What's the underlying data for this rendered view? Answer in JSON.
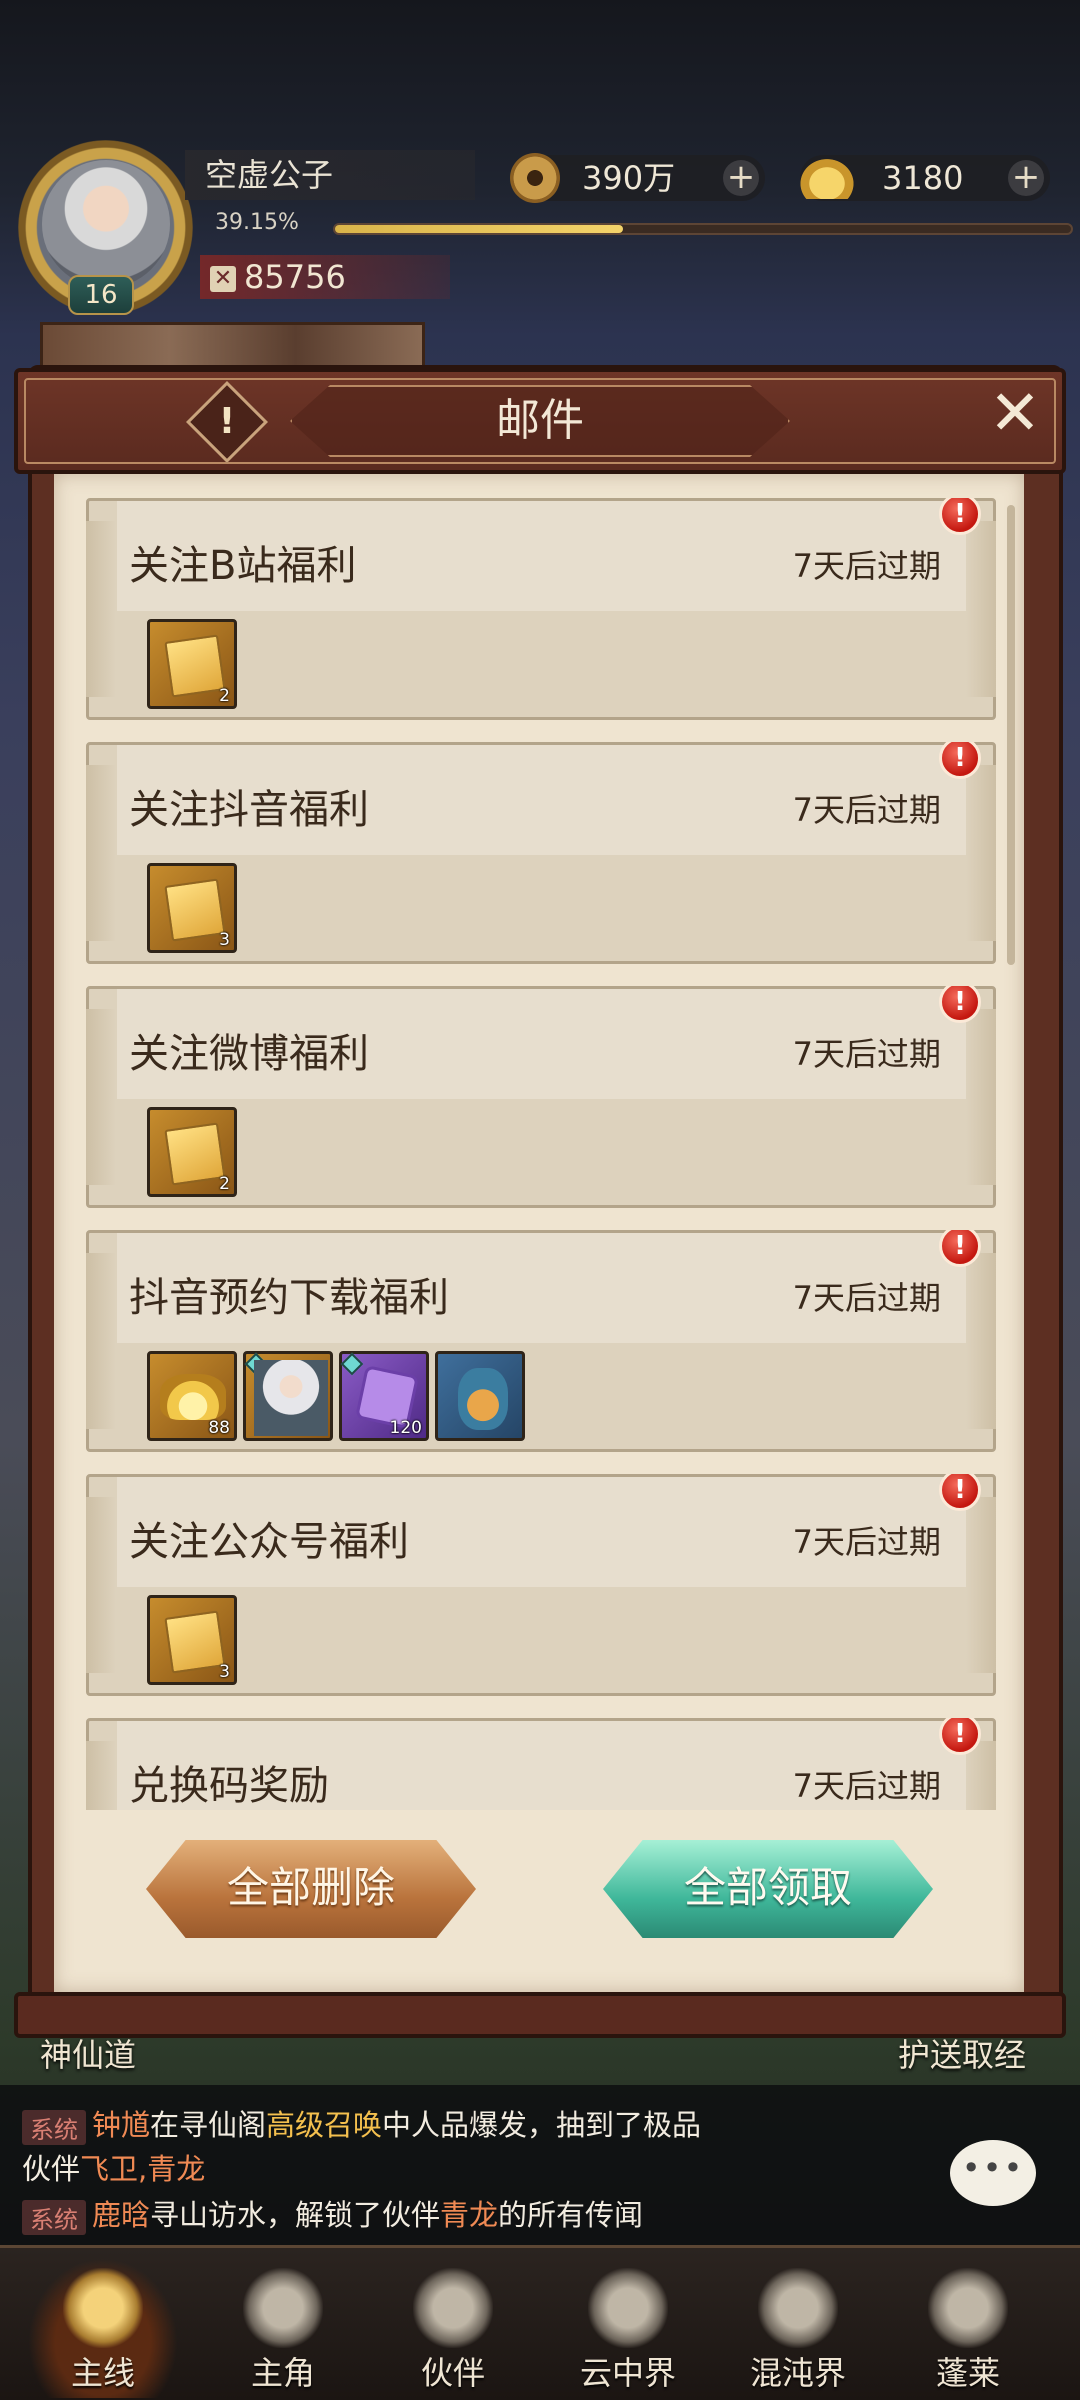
{
  "player": {
    "name": "空虚公子",
    "level": "16",
    "exp_percent": "39.15%",
    "exp_fraction": 0.3915,
    "power": "85756"
  },
  "currency": {
    "coins": "390万",
    "gold": "3180"
  },
  "dialog": {
    "title": "邮件",
    "info_icon": "!",
    "close_icon": "✕"
  },
  "mails": [
    {
      "subject": "关注B站福利",
      "expiry": "7天后过期",
      "items": [
        {
          "kind": "ticket",
          "count": "2"
        }
      ]
    },
    {
      "subject": "关注抖音福利",
      "expiry": "7天后过期",
      "items": [
        {
          "kind": "ticket",
          "count": "3"
        }
      ]
    },
    {
      "subject": "关注微博福利",
      "expiry": "7天后过期",
      "items": [
        {
          "kind": "ticket",
          "count": "2"
        }
      ]
    },
    {
      "subject": "抖音预约下载福利",
      "expiry": "7天后过期",
      "items": [
        {
          "kind": "gold-ingot",
          "count": "88"
        },
        {
          "kind": "hero-portrait",
          "count": ""
        },
        {
          "kind": "puzzle-piece",
          "count": "120"
        },
        {
          "kind": "owl-pet",
          "count": ""
        }
      ]
    },
    {
      "subject": "关注公众号福利",
      "expiry": "7天后过期",
      "items": [
        {
          "kind": "ticket",
          "count": "3"
        }
      ]
    },
    {
      "subject": "兑换码奖励",
      "expiry": "7天后过期",
      "items": []
    }
  ],
  "buttons": {
    "delete_all": "全部删除",
    "claim_all": "全部领取"
  },
  "background_labels": {
    "left": "神仙道",
    "right": "护送取经"
  },
  "chat": {
    "system_tag": "系统",
    "line1_name": "钟馗",
    "line1_text_a": "在寻仙阁",
    "line1_event": "高级召唤",
    "line1_text_b": "中人品爆发，抽到了极品",
    "line2_text": "伙伴",
    "line2_items": "飞卫,青龙",
    "line3_name": "鹿晗",
    "line3_text_a": "寻山访水，解锁了伙伴",
    "line3_event": "青龙",
    "line3_text_b": "的所有传闻",
    "bubble": "•••"
  },
  "nav": [
    {
      "label": "主线",
      "icon": "crossed-swords-icon",
      "active": true
    },
    {
      "label": "主角",
      "icon": "hero-head-icon",
      "active": false
    },
    {
      "label": "伙伴",
      "icon": "companion-icon",
      "active": false
    },
    {
      "label": "云中界",
      "icon": "pagoda-icon",
      "active": false
    },
    {
      "label": "混沌界",
      "icon": "chaos-portal-icon",
      "active": false
    },
    {
      "label": "蓬莱",
      "icon": "immortal-icon",
      "active": false
    }
  ]
}
